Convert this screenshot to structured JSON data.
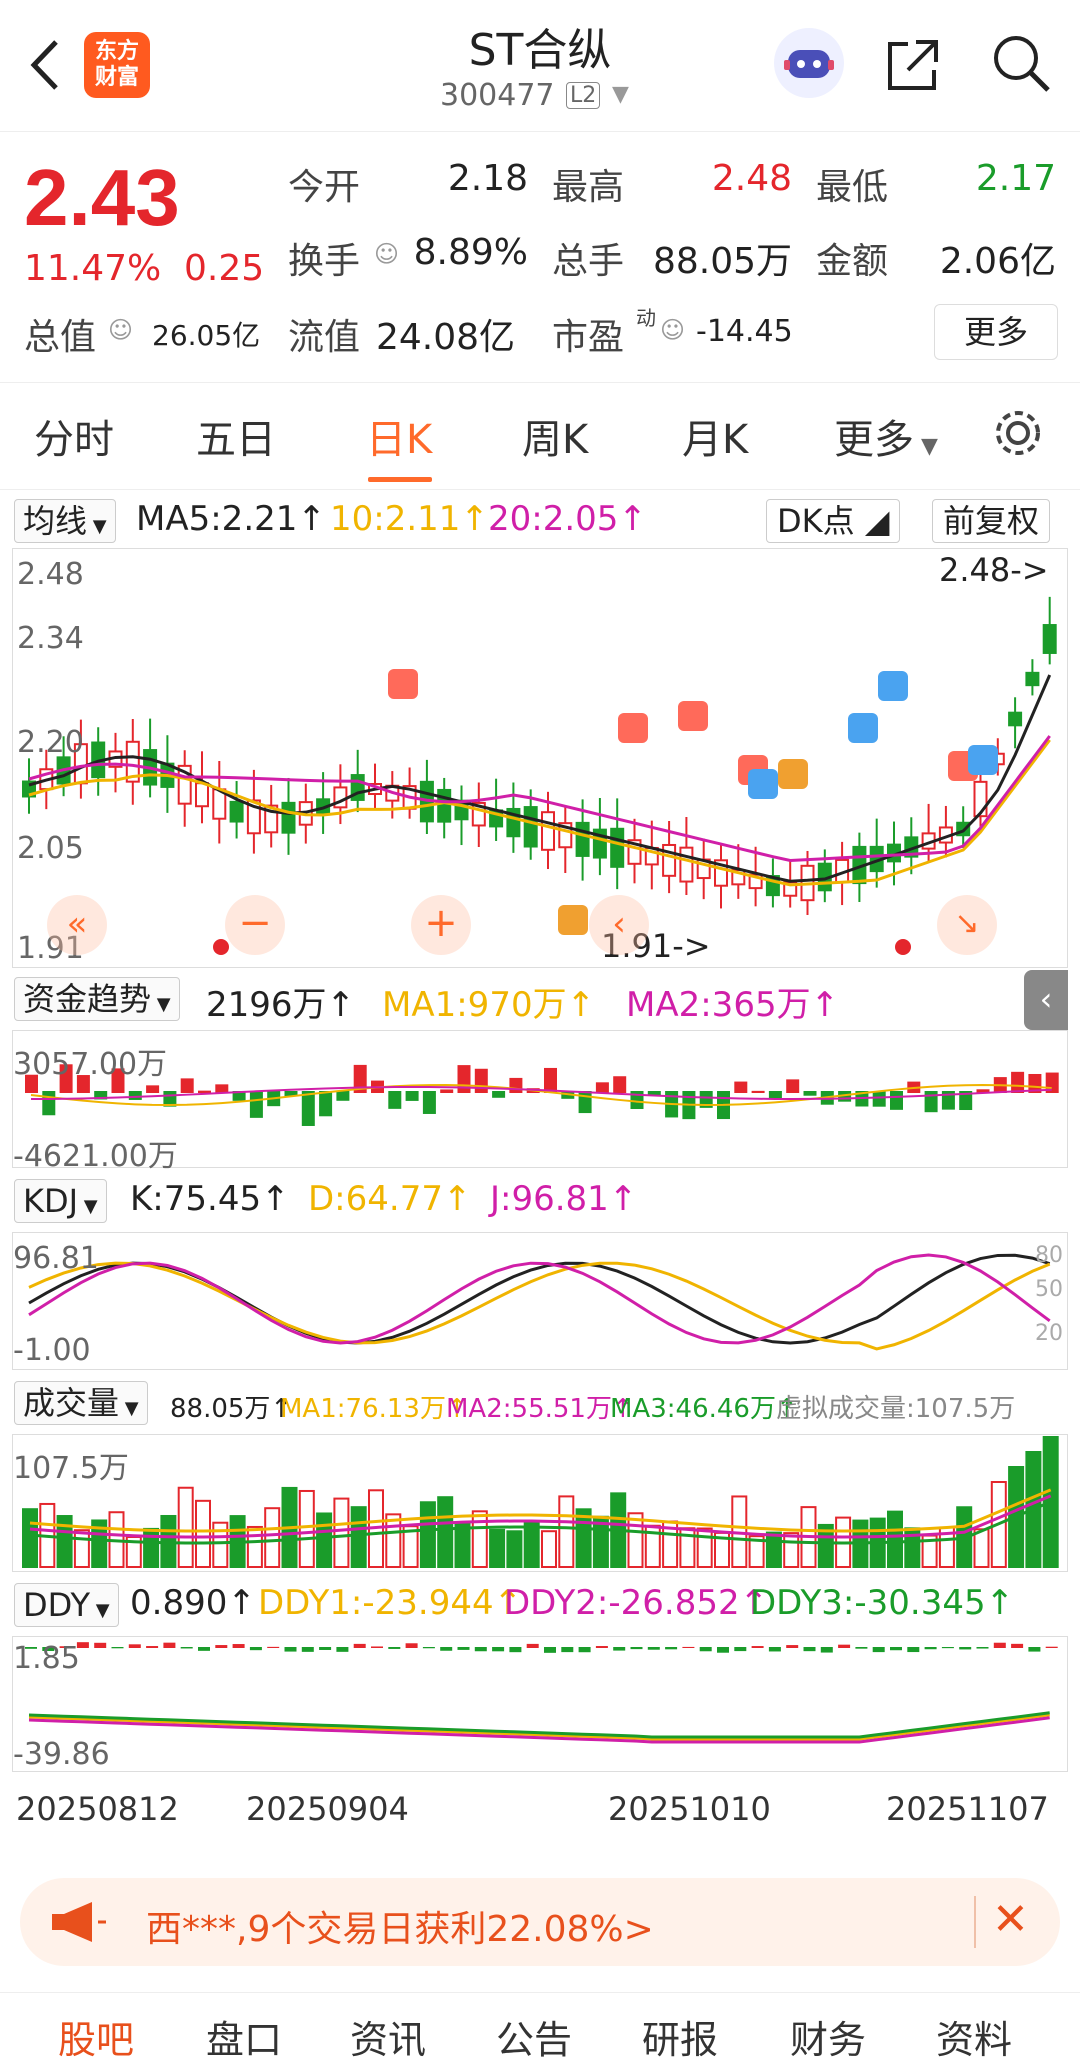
{
  "header": {
    "title": "ST合纵",
    "code": "300477",
    "level_badge": "L2",
    "logo_line1": "东方",
    "logo_line2": "财富",
    "icons": [
      "back-icon",
      "robot-assistant-icon",
      "share-icon",
      "search-icon"
    ]
  },
  "quote": {
    "price": "2.43",
    "change_pct": "11.47%",
    "change_abs": "0.25",
    "open_label": "今开",
    "open": "2.18",
    "high_label": "最高",
    "high": "2.48",
    "low_label": "最低",
    "low": "2.17",
    "turnover_label": "换手",
    "turnover": "8.89%",
    "volume_label": "总手",
    "volume": "88.05万",
    "amount_label": "金额",
    "amount": "2.06亿",
    "mktcap_label": "总值",
    "mktcap": "26.05亿",
    "float_label": "流值",
    "float_cap": "24.08亿",
    "pe_label": "市盈",
    "pe_sup": "动",
    "pe": "-14.45",
    "more_label": "更多",
    "colors": {
      "up": "#e4262c",
      "down": "#1a9c2a",
      "accent": "#ff6a2b"
    }
  },
  "period_tabs": [
    {
      "label": "分时",
      "active": false
    },
    {
      "label": "五日",
      "active": false
    },
    {
      "label": "日K",
      "active": true
    },
    {
      "label": "周K",
      "active": false
    },
    {
      "label": "月K",
      "active": false
    },
    {
      "label": "更多",
      "active": false
    }
  ],
  "kline": {
    "ma_selector": "均线",
    "ma5": "MA5:2.21↑",
    "ma10": "10:2.11↑",
    "ma20": "20:2.05↑",
    "dk_label": "DK点",
    "adjust_label": "前复权",
    "y_labels": [
      "2.48",
      "2.34",
      "2.20",
      "2.05",
      "1.91"
    ],
    "high_marker": "2.48->",
    "low_marker": "1.91->",
    "signals": [
      "B",
      "B",
      "B",
      "B",
      "B",
      "S",
      "S",
      "S",
      "S",
      "T",
      "T",
      "T"
    ]
  },
  "capital_flow": {
    "selector": "资金趋势",
    "value": "2196万↑",
    "ma1": "MA1:970万↑",
    "ma2": "MA2:365万↑",
    "y_top": "3057.00万",
    "y_bottom": "-4621.00万"
  },
  "kdj": {
    "selector": "KDJ",
    "k": "K:75.45↑",
    "d": "D:64.77↑",
    "j": "J:96.81↑",
    "y_top": "96.81",
    "y_bottom": "-1.00",
    "levels": [
      "80",
      "50",
      "20"
    ]
  },
  "volume": {
    "selector": "成交量",
    "value": "88.05万↑",
    "ma1": "MA1:76.13万↑",
    "ma2": "MA2:55.51万↑",
    "ma3": "MA3:46.46万↑",
    "virtual": "虚拟成交量:107.5万",
    "y_top": "107.5万"
  },
  "ddy": {
    "selector": "DDY",
    "value": "0.890↑",
    "ddy1": "DDY1:-23.944↑",
    "ddy2": "DDY2:-26.852↑",
    "ddy3": "DDY3:-30.345↑",
    "y_top": "1.85",
    "y_bottom": "-39.86"
  },
  "x_dates": [
    "20250812",
    "20250904",
    "20251010",
    "20251107"
  ],
  "banner": {
    "text": "西***,9个交易日获利22.08%>"
  },
  "bottom_tabs": [
    "股吧",
    "盘口",
    "资讯",
    "公告",
    "研报",
    "财务",
    "资料"
  ]
}
